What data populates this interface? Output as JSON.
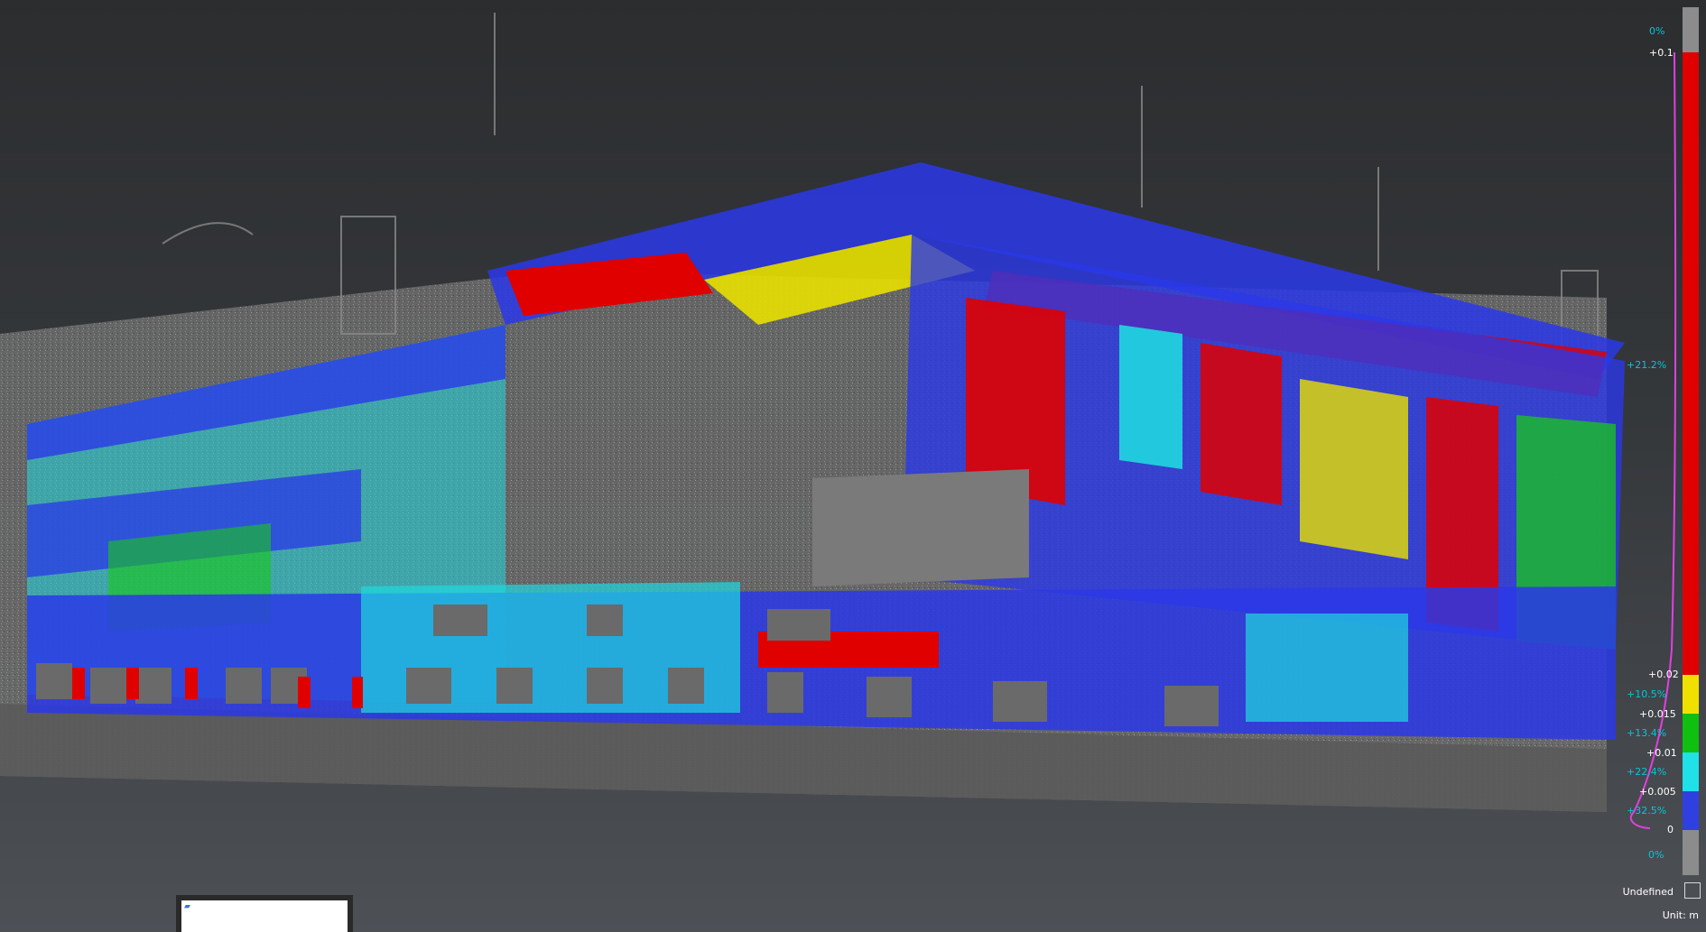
{
  "viewer": {
    "colors": {
      "background_top": "#2b2d2f",
      "background_bottom": "#4d5156",
      "ground": "#6a6a6a",
      "structure_gray": "#7a7a7a",
      "deviation_red": "#e00000",
      "deviation_yellow": "#e8e000",
      "deviation_green": "#18c818",
      "deviation_cyan": "#20d8e0",
      "deviation_blue": "#2a38e8",
      "histogram_curve": "#e040e0"
    }
  },
  "scale_bar": {
    "top_pct": "0%",
    "max_value": "+0.1",
    "red_pct": "+21.2%",
    "value_002": "+0.02",
    "yellow_pct": "+10.5%",
    "value_0015": "+0.015",
    "green_pct": "+13.4%",
    "value_001": "+0.01",
    "cyan_pct": "+22.4%",
    "value_0005": "+0.005",
    "blue_pct": "+32.5%",
    "zero_value": "0",
    "bottom_pct": "0%",
    "undefined_label": "Undefined",
    "unit_label": "Unit: m",
    "segment_colors": {
      "gray": "#8c8c8c",
      "red": "#e00000",
      "yellow": "#f0e000",
      "green": "#10c010",
      "cyan": "#20e0e8",
      "blue": "#3040e0"
    }
  },
  "mini_window": {
    "icon": "app-icon"
  }
}
